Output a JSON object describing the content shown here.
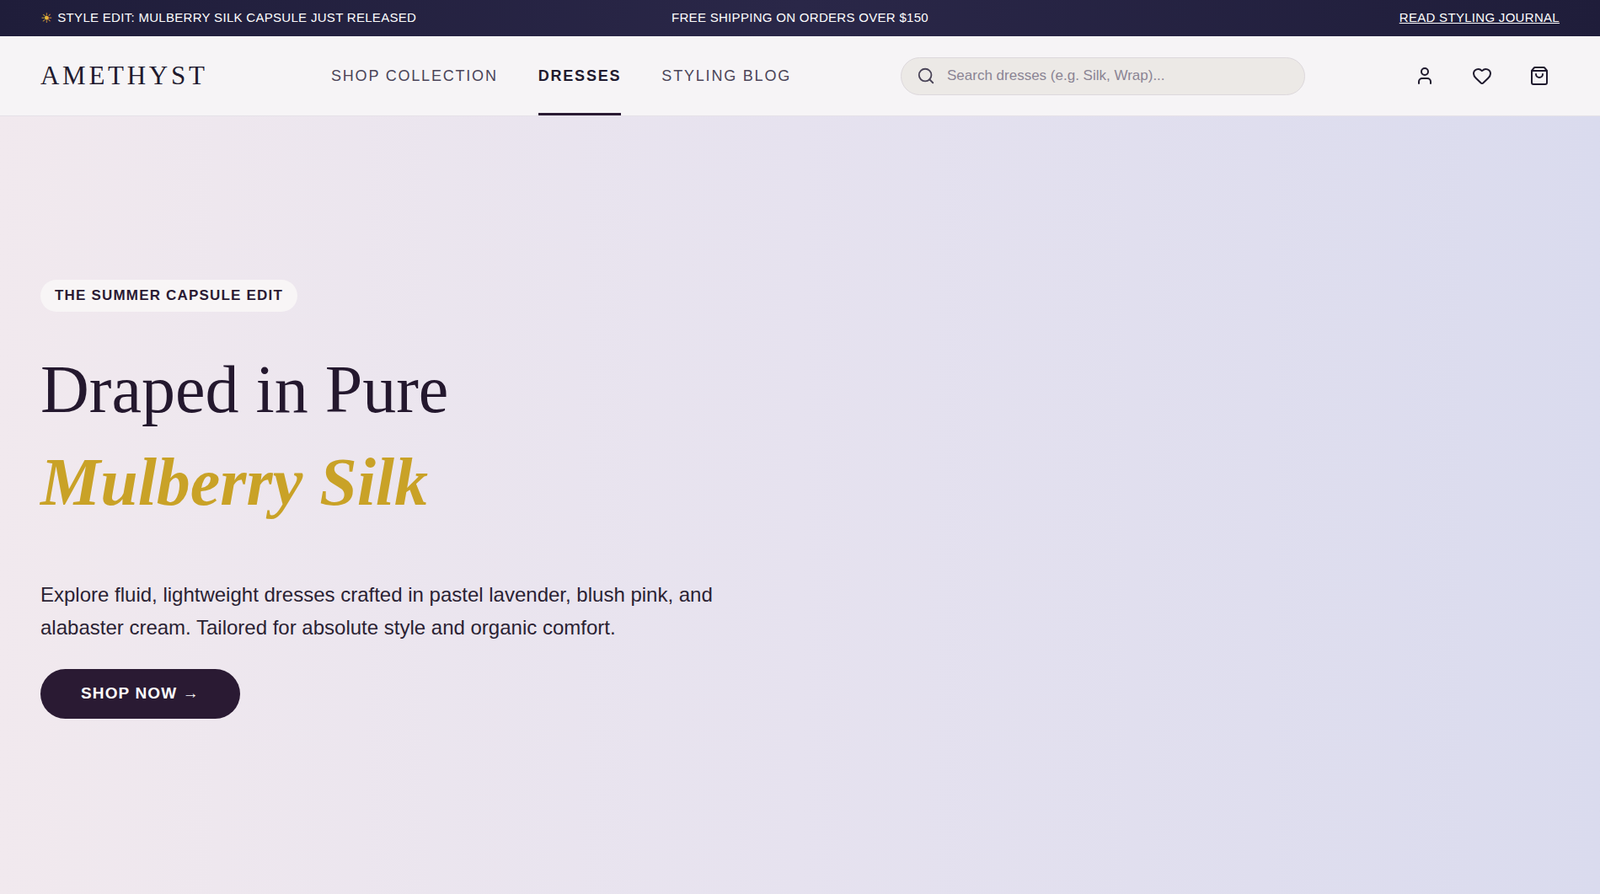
{
  "announcement": {
    "icon": "☀",
    "left": "STYLE EDIT: MULBERRY SILK CAPSULE JUST RELEASED",
    "center": "FREE SHIPPING ON ORDERS OVER $150",
    "link": "READ STYLING JOURNAL"
  },
  "header": {
    "logo": "AMETHYST",
    "nav": [
      {
        "label": "SHOP COLLECTION",
        "selected": false
      },
      {
        "label": "DRESSES",
        "selected": true
      },
      {
        "label": "STYLING BLOG",
        "selected": false
      }
    ],
    "search": {
      "placeholder": "Search dresses (e.g. Silk, Wrap)..."
    }
  },
  "hero": {
    "badge": "THE SUMMER CAPSULE EDIT",
    "heading": "Draped in Pure",
    "heading_accent": "Mulberry Silk",
    "description": "Explore fluid, lightweight dresses crafted in pastel lavender, blush pink, and alabaster cream. Tailored for absolute style and organic comfort.",
    "button": "SHOP NOW →"
  }
}
